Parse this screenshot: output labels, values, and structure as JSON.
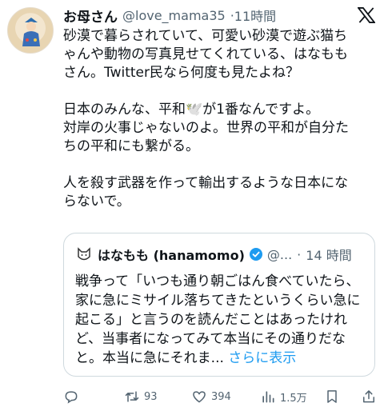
{
  "tweet": {
    "display_name": "お母さん",
    "handle": "@love_mama35",
    "separator": "·",
    "time": "11時間",
    "lines": [
      "砂漠で暮らされていて、可愛い砂漠で遊ぶ猫ち",
      "ゃんや動物の写真見せてくれている、はなもも",
      "さん。Twitter民なら何度も見たよね？",
      "",
      "日本のみんな、平和🕊️が1番なんですよ。",
      "対岸の火事じゃないのよ。世界の平和が自分た",
      "ちの平和にも繋がる。",
      "",
      "人を殺す武器を作って輸出するような日本にな",
      "らないで。"
    ]
  },
  "quote": {
    "display_name": "はなもも (hanamomo)",
    "handle": "@...",
    "separator": "·",
    "time": "14 時間",
    "text": "戦争って「いつも通り朝ごはん食べていたら、家に急にミサイル落ちてきたというくらい急に起こる」と言うのを読んだことはあったけれど、当事者になってみて本当にその通りだなと。本当に急にそれま...",
    "show_more": "さらに表示"
  },
  "actions": {
    "replies": "",
    "retweets": "93",
    "likes": "394",
    "views": "1.5万"
  },
  "icons": {
    "logo": "x-logo-icon",
    "reply": "reply-icon",
    "retweet": "retweet-icon",
    "like": "heart-icon",
    "views": "views-icon",
    "bookmark": "bookmark-icon",
    "share": "share-icon"
  },
  "colors": {
    "text": "#0f1419",
    "secondary": "#536471",
    "link": "#1d9bf0",
    "border": "#cfd9de"
  }
}
